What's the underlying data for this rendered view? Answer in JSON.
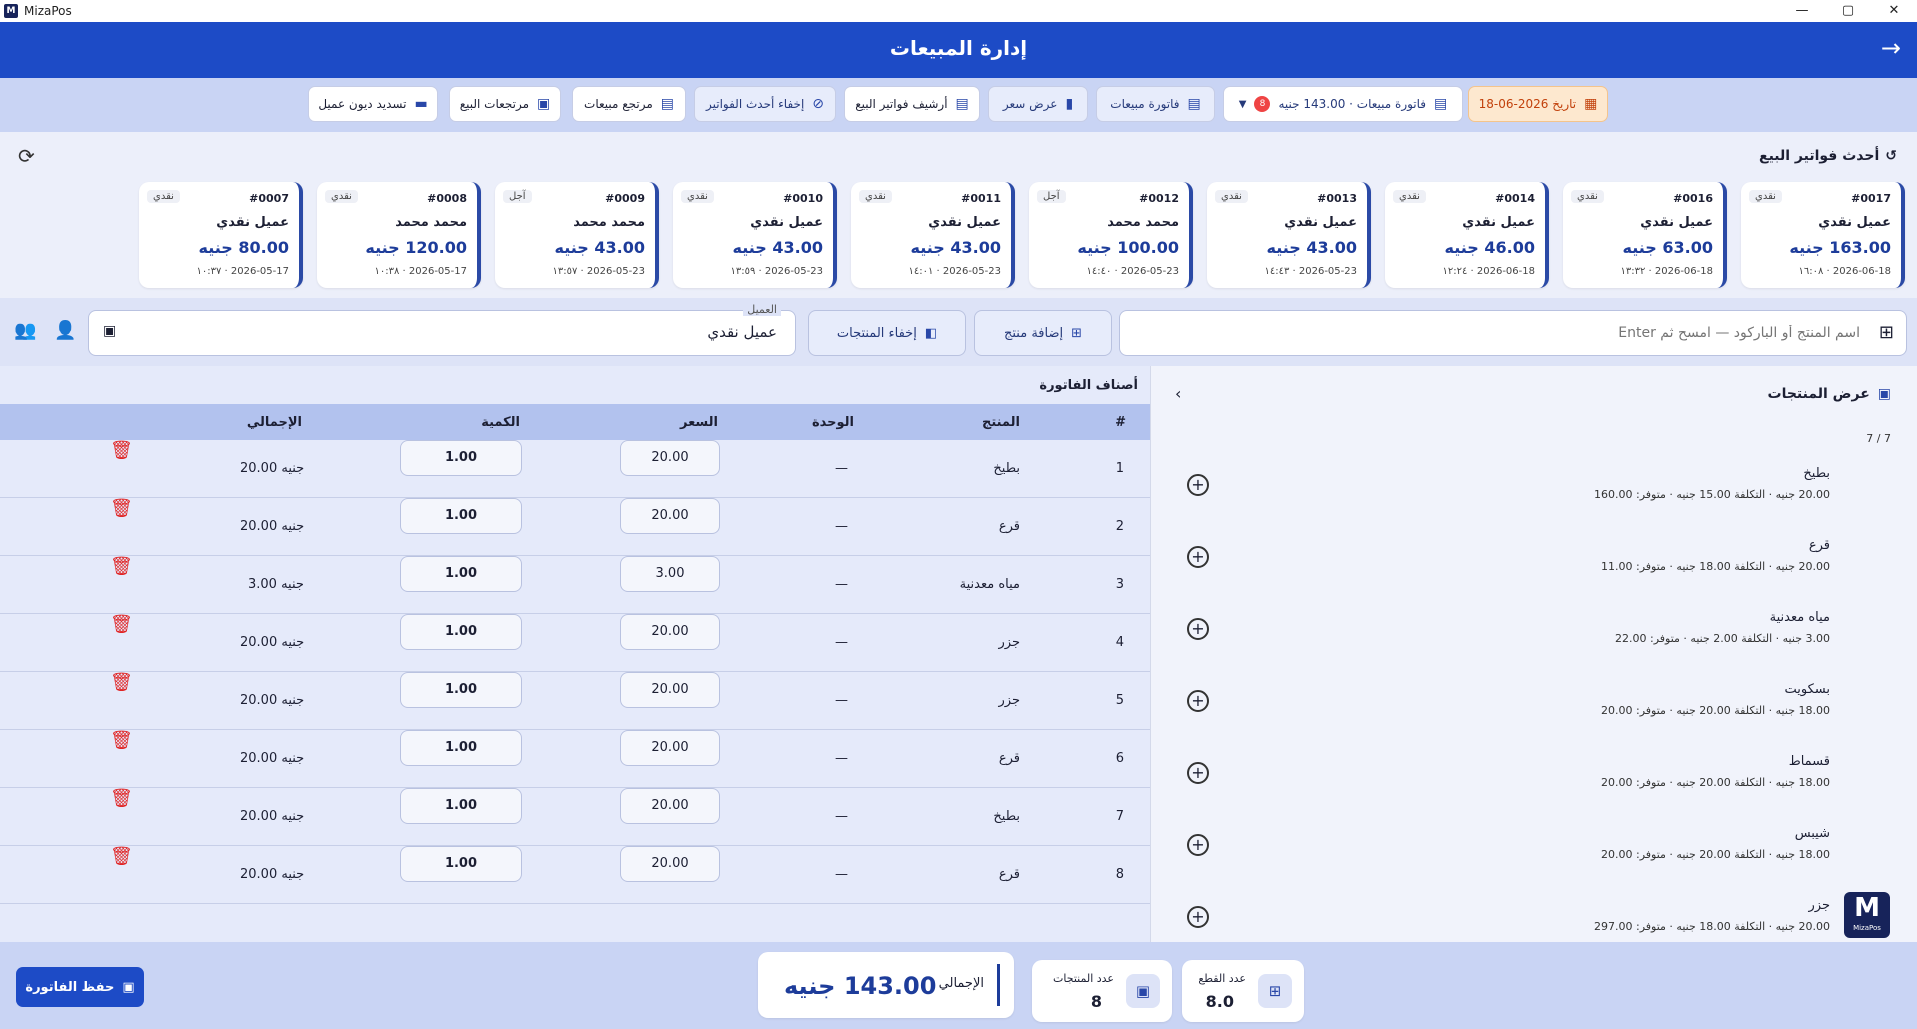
{
  "app": {
    "name": "MizaPos",
    "window_buttons": [
      "—",
      "▢",
      "✕"
    ]
  },
  "header": {
    "title": "إدارة المبيعات",
    "back_icon": "→"
  },
  "toolbar": {
    "date": "تاريخ 2026-06-18",
    "invoice_select": "فاتورة مبيعات · 143.00 جنيه",
    "invoice_badge": "8",
    "sales_invoice": "فاتورة مبيعات",
    "quote": "عرض سعر",
    "archive": "أرشيف فواتير البيع",
    "hide_recent": "إخفاء أحدث الفواتير",
    "sales_return": "مرتجع مبيعات",
    "returns": "مرتجعات البيع",
    "debt_payment": "تسديد ديون عميل"
  },
  "recent": {
    "title": "أحدث فواتير البيع",
    "invoices": [
      {
        "num": "#0017",
        "tag": "نقدي",
        "customer": "عميل نقدي",
        "amount": "163.00 جنيه",
        "datetime": "2026-06-18 · ١٦:٠٨"
      },
      {
        "num": "#0016",
        "tag": "نقدي",
        "customer": "عميل نقدي",
        "amount": "63.00 جنيه",
        "datetime": "2026-06-18 · ١٣:٣٢"
      },
      {
        "num": "#0014",
        "tag": "نقدي",
        "customer": "عميل نقدي",
        "amount": "46.00 جنيه",
        "datetime": "2026-06-18 · ١٢:٢٤"
      },
      {
        "num": "#0013",
        "tag": "نقدي",
        "customer": "عميل نقدي",
        "amount": "43.00 جنيه",
        "datetime": "2026-05-23 · ١٤:٤٣"
      },
      {
        "num": "#0012",
        "tag": "آجل",
        "customer": "محمد محمد",
        "amount": "100.00 جنيه",
        "datetime": "2026-05-23 · ١٤:٤٠"
      },
      {
        "num": "#0011",
        "tag": "نقدي",
        "customer": "عميل نقدي",
        "amount": "43.00 جنيه",
        "datetime": "2026-05-23 · ١٤:٠١"
      },
      {
        "num": "#0010",
        "tag": "نقدي",
        "customer": "عميل نقدي",
        "amount": "43.00 جنيه",
        "datetime": "2026-05-23 · ١٣:٥٩"
      },
      {
        "num": "#0009",
        "tag": "آجل",
        "customer": "محمد محمد",
        "amount": "43.00 جنيه",
        "datetime": "2026-05-23 · ١٣:٥٧"
      },
      {
        "num": "#0008",
        "tag": "نقدي",
        "customer": "محمد محمد",
        "amount": "120.00 جنيه",
        "datetime": "2026-05-17 · ١٠:٣٨"
      },
      {
        "num": "#0007",
        "tag": "نقدي",
        "customer": "عميل نقدي",
        "amount": "80.00 جنيه",
        "datetime": "2026-05-17 · ١٠:٣٧"
      }
    ]
  },
  "search": {
    "placeholder": "اسم المنتج أو الباركود — امسح ثم Enter"
  },
  "actions": {
    "add_product": "إضافة منتج",
    "hide_products": "إخفاء المنتجات"
  },
  "customer": {
    "label": "العميل",
    "value": "عميل نقدي"
  },
  "invoice": {
    "title": "أصناف الفاتورة",
    "columns": {
      "index": "#",
      "product": "المنتج",
      "unit": "الوحدة",
      "price": "السعر",
      "qty": "الكمية",
      "total": "الإجمالي"
    },
    "rows": [
      {
        "index": "1",
        "product": "بطيخ",
        "unit": "—",
        "price": "20.00",
        "qty": "1.00",
        "total": "20.00 جنيه"
      },
      {
        "index": "2",
        "product": "قرع",
        "unit": "—",
        "price": "20.00",
        "qty": "1.00",
        "total": "20.00 جنيه"
      },
      {
        "index": "3",
        "product": "مياه معدنية",
        "unit": "—",
        "price": "3.00",
        "qty": "1.00",
        "total": "3.00 جنيه"
      },
      {
        "index": "4",
        "product": "جزر",
        "unit": "—",
        "price": "20.00",
        "qty": "1.00",
        "total": "20.00 جنيه"
      },
      {
        "index": "5",
        "product": "جزر",
        "unit": "—",
        "price": "20.00",
        "qty": "1.00",
        "total": "20.00 جنيه"
      },
      {
        "index": "6",
        "product": "قرع",
        "unit": "—",
        "price": "20.00",
        "qty": "1.00",
        "total": "20.00 جنيه"
      },
      {
        "index": "7",
        "product": "بطيخ",
        "unit": "—",
        "price": "20.00",
        "qty": "1.00",
        "total": "20.00 جنيه"
      },
      {
        "index": "8",
        "product": "قرع",
        "unit": "—",
        "price": "20.00",
        "qty": "1.00",
        "total": "20.00 جنيه"
      }
    ]
  },
  "products": {
    "title": "عرض المنتجات",
    "count": "7 / 7",
    "items": [
      {
        "name": "بطيخ",
        "info": "20.00 جنيه · التكلفة 15.00 جنيه · متوفر: 160.00"
      },
      {
        "name": "قرع",
        "info": "20.00 جنيه · التكلفة 18.00 جنيه · متوفر: 11.00"
      },
      {
        "name": "مياه معدنية",
        "info": "3.00 جنيه · التكلفة 2.00 جنيه · متوفر: 22.00"
      },
      {
        "name": "بسكويت",
        "info": "18.00 جنيه · التكلفة 20.00 جنيه · متوفر: 20.00"
      },
      {
        "name": "قسماط",
        "info": "18.00 جنيه · التكلفة 20.00 جنيه · متوفر: 20.00"
      },
      {
        "name": "شيبس",
        "info": "18.00 جنيه · التكلفة 20.00 جنيه · متوفر: 20.00"
      },
      {
        "name": "جزر",
        "info": "20.00 جنيه · التكلفة 18.00 جنيه · متوفر: 297.00"
      }
    ]
  },
  "logo": {
    "text": "MizaPos"
  },
  "footer": {
    "save": "حفظ الفاتورة",
    "pieces_label": "عدد القطع",
    "pieces_value": "8.0",
    "products_label": "عدد المنتجات",
    "products_value": "8",
    "total_label": "الإجمالي",
    "total_value": "143.00 جنيه"
  }
}
